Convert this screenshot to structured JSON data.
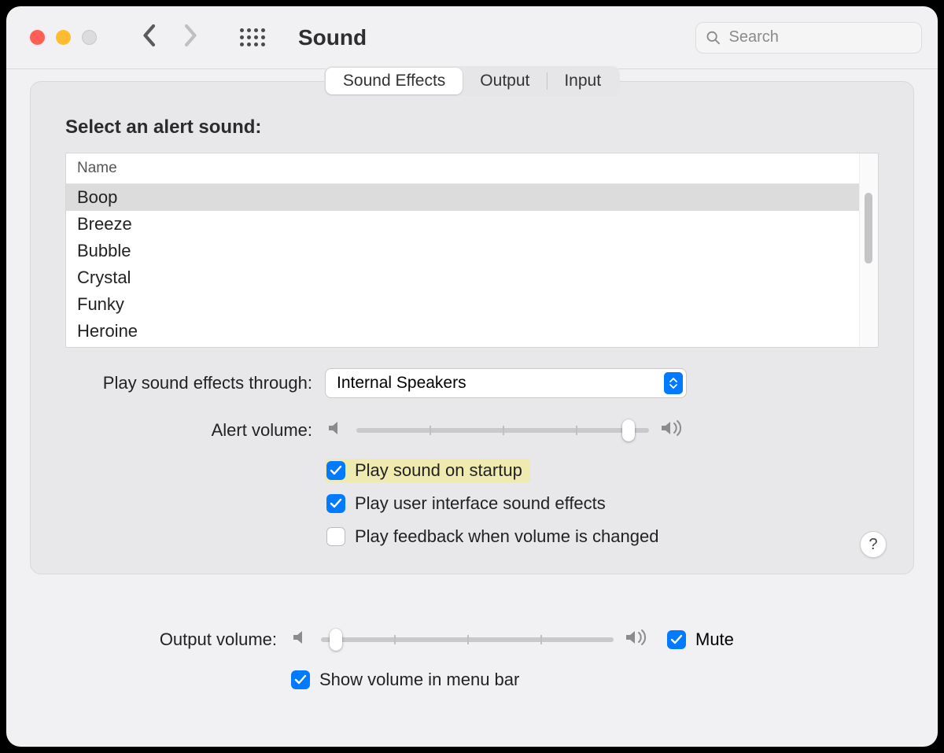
{
  "header": {
    "title": "Sound",
    "search_placeholder": "Search"
  },
  "tabs": [
    {
      "label": "Sound Effects",
      "active": true
    },
    {
      "label": "Output",
      "active": false
    },
    {
      "label": "Input",
      "active": false
    }
  ],
  "section_title": "Select an alert sound:",
  "table": {
    "column": "Name",
    "rows": [
      "Boop",
      "Breeze",
      "Bubble",
      "Crystal",
      "Funky",
      "Heroine"
    ],
    "selected_index": 0
  },
  "play_through": {
    "label": "Play sound effects through:",
    "value": "Internal Speakers"
  },
  "alert_volume": {
    "label": "Alert volume:",
    "value_pct": 93
  },
  "checks": {
    "startup": {
      "label": "Play sound on startup",
      "checked": true,
      "highlight": true
    },
    "ui": {
      "label": "Play user interface sound effects",
      "checked": true
    },
    "feedback": {
      "label": "Play feedback when volume is changed",
      "checked": false
    }
  },
  "output_volume": {
    "label": "Output volume:",
    "value_pct": 5,
    "mute_label": "Mute",
    "mute_checked": true
  },
  "show_menu": {
    "label": "Show volume in menu bar",
    "checked": true
  },
  "help_label": "?"
}
